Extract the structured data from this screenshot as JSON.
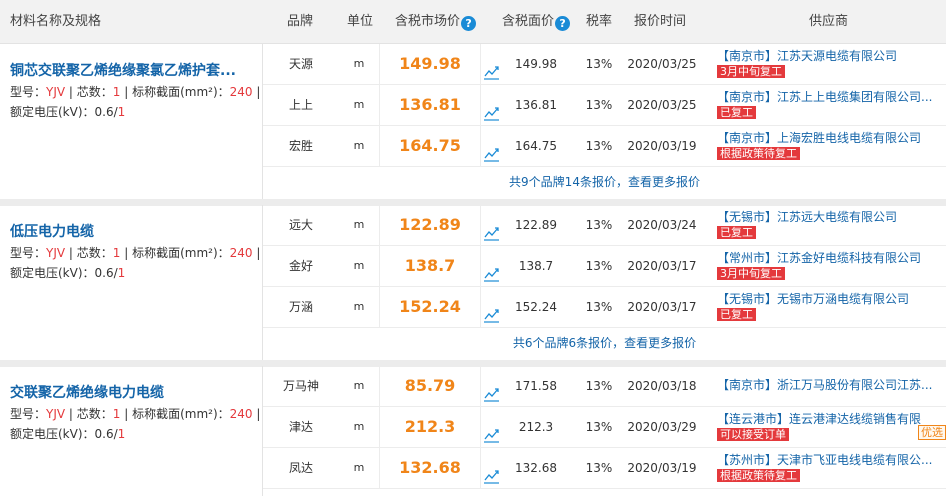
{
  "header": {
    "col_name": "材料名称及规格",
    "col_brand": "品牌",
    "col_unit": "单位",
    "col_market_price": "含税市场价",
    "col_face_price": "含税面价",
    "col_tax": "税率",
    "col_date": "报价时间",
    "col_supplier": "供应商",
    "help_glyph": "?"
  },
  "groups": [
    {
      "name": "铜芯交联聚乙烯绝缘聚氯乙烯护套...",
      "spec": {
        "model_label": "型号：",
        "model": "YJV",
        "sep1": " | ",
        "cores_label": "芯数：",
        "cores": "1",
        "sep2": " | ",
        "section_label": "标称截面(mm²)：",
        "section": "240",
        "sep3": " |",
        "voltage_label": "额定电压(kV)：",
        "voltage_a": "0.6/",
        "voltage_b": "1"
      },
      "rows": [
        {
          "brand": "天源",
          "unit": "m",
          "price": "149.98",
          "face": "149.98",
          "tax": "13%",
          "date": "2020/03/25",
          "city": "【南京市】",
          "supplier": "江苏天源电缆有限公司",
          "tag": "3月中旬复工"
        },
        {
          "brand": "上上",
          "unit": "m",
          "price": "136.81",
          "face": "136.81",
          "tax": "13%",
          "date": "2020/03/25",
          "city": "【南京市】",
          "supplier": "江苏上上电缆集团有限公司...",
          "tag": "已复工"
        },
        {
          "brand": "宏胜",
          "unit": "m",
          "price": "164.75",
          "face": "164.75",
          "tax": "13%",
          "date": "2020/03/19",
          "city": "【南京市】",
          "supplier": "上海宏胜电线电缆有限公司",
          "tag": "根据政策待复工"
        }
      ],
      "more": "共9个品牌14条报价，查看更多报价"
    },
    {
      "name": "低压电力电缆",
      "spec": {
        "model_label": "型号：",
        "model": "YJV",
        "sep1": " | ",
        "cores_label": "芯数：",
        "cores": "1",
        "sep2": " | ",
        "section_label": "标称截面(mm²)：",
        "section": "240",
        "sep3": " |",
        "voltage_label": "额定电压(kV)：",
        "voltage_a": "0.6/",
        "voltage_b": "1"
      },
      "rows": [
        {
          "brand": "远大",
          "unit": "m",
          "price": "122.89",
          "face": "122.89",
          "tax": "13%",
          "date": "2020/03/24",
          "city": "【无锡市】",
          "supplier": "江苏远大电缆有限公司",
          "tag": "已复工"
        },
        {
          "brand": "金好",
          "unit": "m",
          "price": "138.7",
          "face": "138.7",
          "tax": "13%",
          "date": "2020/03/17",
          "city": "【常州市】",
          "supplier": "江苏金好电缆科技有限公司",
          "tag": "3月中旬复工"
        },
        {
          "brand": "万涵",
          "unit": "m",
          "price": "152.24",
          "face": "152.24",
          "tax": "13%",
          "date": "2020/03/17",
          "city": "【无锡市】",
          "supplier": "无锡市万涵电缆有限公司",
          "tag": "已复工"
        }
      ],
      "more": "共6个品牌6条报价，查看更多报价"
    },
    {
      "name": "交联聚乙烯绝缘电力电缆",
      "spec": {
        "model_label": "型号：",
        "model": "YJV",
        "sep1": " | ",
        "cores_label": "芯数：",
        "cores": "1",
        "sep2": " | ",
        "section_label": "标称截面(mm²)：",
        "section": "240",
        "sep3": " |",
        "voltage_label": "额定电压(kV)：",
        "voltage_a": "0.6/",
        "voltage_b": "1"
      },
      "rows": [
        {
          "brand": "万马神",
          "unit": "m",
          "price": "85.79",
          "face": "171.58",
          "tax": "13%",
          "date": "2020/03/18",
          "city": "【南京市】",
          "supplier": "浙江万马股份有限公司江苏...",
          "tag": ""
        },
        {
          "brand": "津达",
          "unit": "m",
          "price": "212.3",
          "face": "212.3",
          "tax": "13%",
          "date": "2020/03/29",
          "city": "【连云港市】",
          "supplier": "连云港津达线缆销售有限...",
          "tag": "可以接受订单",
          "side_tag": "优选"
        },
        {
          "brand": "凤达",
          "unit": "m",
          "price": "132.68",
          "face": "132.68",
          "tax": "13%",
          "date": "2020/03/19",
          "city": "【苏州市】",
          "supplier": "天津市飞亚电线电缆有限公...",
          "tag": "根据政策待复工"
        }
      ],
      "more": ""
    }
  ],
  "icons": {
    "trend": "trend-chart-icon",
    "help": "question-circle-icon"
  },
  "colors": {
    "price": "#f08519",
    "link": "#1464a8",
    "tag": "#e4393c",
    "help": "#1a8bd6"
  }
}
